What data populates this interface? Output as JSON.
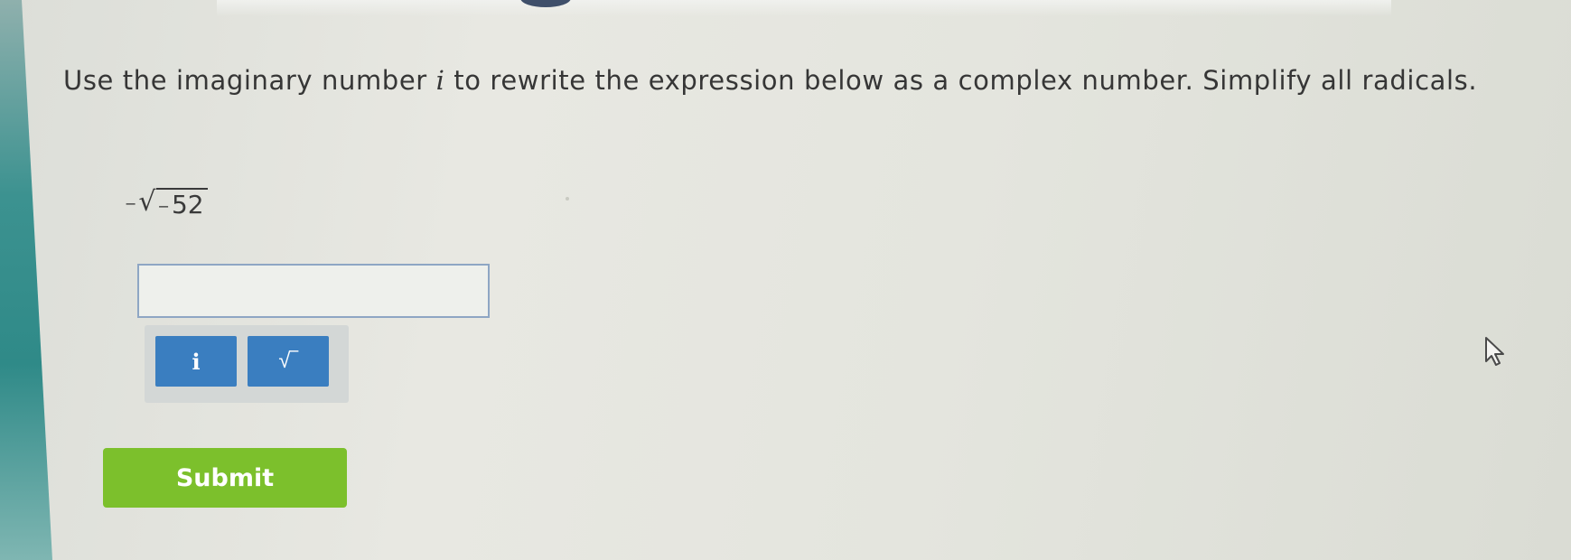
{
  "question": {
    "text_before": "Use the imaginary number ",
    "variable": "i",
    "text_after": " to rewrite the expression below as a complex number. Simplify all radicals."
  },
  "expression": {
    "outer_sign": "−",
    "radicand_sign": "−",
    "radicand_value": "52"
  },
  "answer": {
    "value": "",
    "placeholder": ""
  },
  "keypad": {
    "i_key_label": "i",
    "sqrt_key_label": "√‾"
  },
  "submit": {
    "label": "Submit"
  },
  "colors": {
    "accent_teal": "#2f8a88",
    "key_blue": "#3a7ec0",
    "submit_green": "#7cc02c",
    "input_border": "#8ea6c4"
  },
  "icons": {
    "cursor": "mouse-pointer-icon",
    "sqrt": "square-root-icon"
  }
}
